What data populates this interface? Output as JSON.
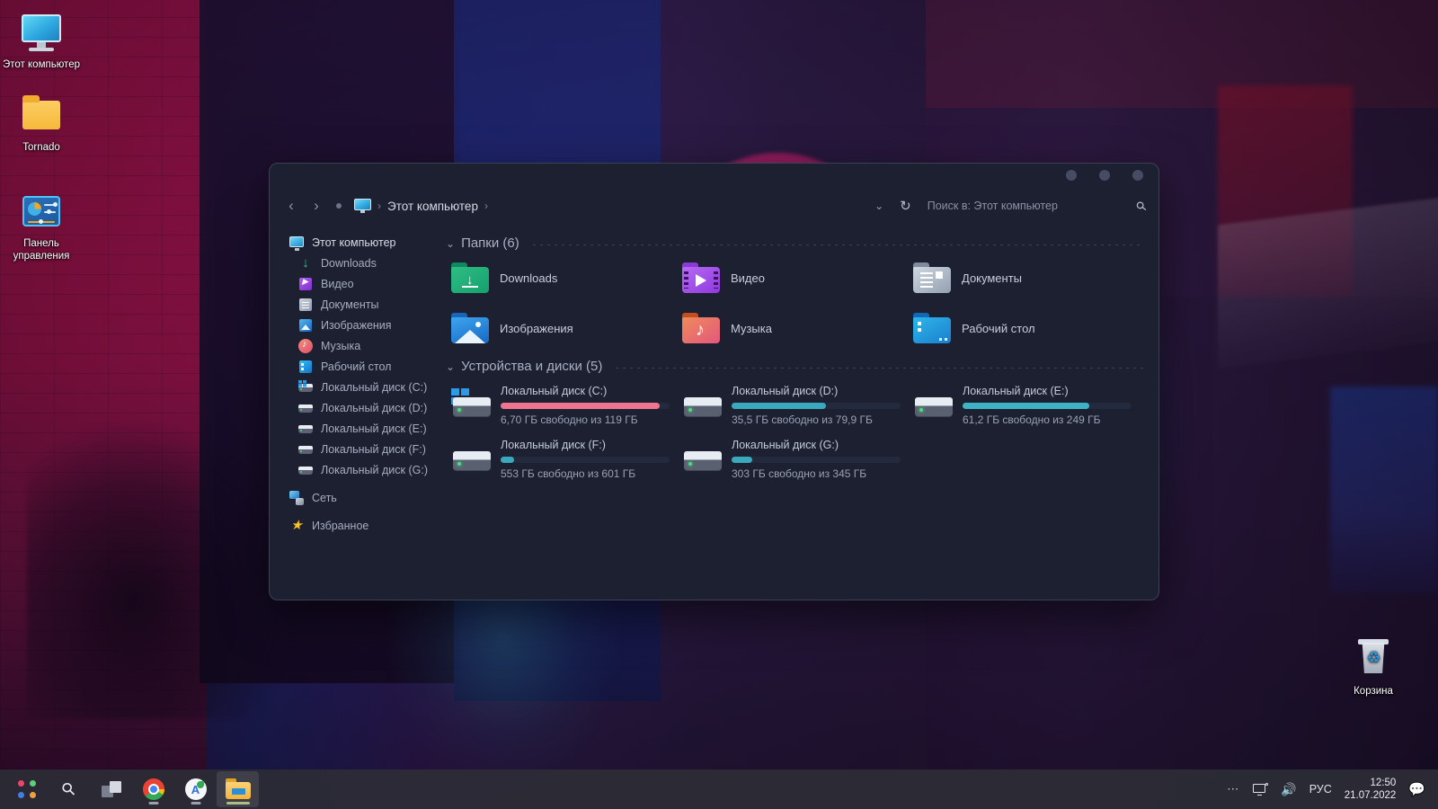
{
  "desktop": {
    "icons": [
      {
        "name": "Этот компьютер",
        "icon": "monitor-icon"
      },
      {
        "name": "Tornado",
        "icon": "folder-icon"
      },
      {
        "name": "Панель управления",
        "icon": "control-panel-icon"
      }
    ],
    "recycle_bin": {
      "label": "Корзина",
      "icon": "recycle-bin-icon"
    }
  },
  "explorer": {
    "nav": {
      "back_icon": "chevron-left-icon",
      "forward_icon": "chevron-right-icon",
      "recent_icon": "dot-icon",
      "breadcrumb_icon": "this-pc-icon",
      "breadcrumb_label": "Этот компьютер",
      "separator": "›",
      "dropdown_icon": "chevron-down-icon",
      "refresh_icon": "refresh-icon",
      "search_placeholder": "Поиск в: Этот компьютер",
      "search_value": "",
      "search_icon": "search-icon"
    },
    "window_controls": {
      "minimize": "minimize-button",
      "maximize": "maximize-button",
      "close": "close-button"
    },
    "sidebar": {
      "items": [
        {
          "label": "Этот компьютер",
          "icon": "this-pc-icon",
          "level": 0
        },
        {
          "label": "Downloads",
          "icon": "downloads-icon",
          "level": 1
        },
        {
          "label": "Видео",
          "icon": "video-icon",
          "level": 1
        },
        {
          "label": "Документы",
          "icon": "documents-icon",
          "level": 1
        },
        {
          "label": "Изображения",
          "icon": "pictures-icon",
          "level": 1
        },
        {
          "label": "Музыка",
          "icon": "music-icon",
          "level": 1
        },
        {
          "label": "Рабочий стол",
          "icon": "desktop-icon",
          "level": 1
        },
        {
          "label": "Локальный диск (C:)",
          "icon": "windows-drive-icon",
          "level": 1
        },
        {
          "label": "Локальный диск (D:)",
          "icon": "drive-icon",
          "level": 1
        },
        {
          "label": "Локальный диск (E:)",
          "icon": "drive-icon",
          "level": 1
        },
        {
          "label": "Локальный диск (F:)",
          "icon": "drive-icon",
          "level": 1
        },
        {
          "label": "Локальный диск (G:)",
          "icon": "drive-icon",
          "level": 1
        },
        {
          "label": "Сеть",
          "icon": "network-icon",
          "level": 0
        },
        {
          "label": "Избранное",
          "icon": "star-icon",
          "level": 0
        }
      ]
    },
    "sections": {
      "folders": {
        "title": "Папки (6)",
        "chevron": "chevron-down-icon",
        "items": [
          {
            "name": "Downloads",
            "icon": "downloads-folder-icon"
          },
          {
            "name": "Видео",
            "icon": "video-folder-icon"
          },
          {
            "name": "Документы",
            "icon": "documents-folder-icon"
          },
          {
            "name": "Изображения",
            "icon": "pictures-folder-icon"
          },
          {
            "name": "Музыка",
            "icon": "music-folder-icon"
          },
          {
            "name": "Рабочий стол",
            "icon": "desktop-folder-icon"
          }
        ]
      },
      "drives": {
        "title": "Устройства и диски (5)",
        "chevron": "chevron-down-icon",
        "items": [
          {
            "name": "Локальный диск (C:)",
            "free_text": "6,70 ГБ свободно из 119 ГБ",
            "used_percent": 94,
            "bar_color": "#ef7490",
            "icon": "windows-drive-icon"
          },
          {
            "name": "Локальный диск (D:)",
            "free_text": "35,5 ГБ свободно из 79,9 ГБ",
            "used_percent": 56,
            "bar_color": "#3aa8bd",
            "icon": "drive-icon"
          },
          {
            "name": "Локальный диск (E:)",
            "free_text": "61,2 ГБ свободно из 249 ГБ",
            "used_percent": 75,
            "bar_color": "#3fb3c6",
            "icon": "drive-icon"
          },
          {
            "name": "Локальный диск (F:)",
            "free_text": "553 ГБ свободно из 601 ГБ",
            "used_percent": 8,
            "bar_color": "#3aa8bd",
            "icon": "drive-icon"
          },
          {
            "name": "Локальный диск (G:)",
            "free_text": "303 ГБ свободно из 345 ГБ",
            "used_percent": 12,
            "bar_color": "#3aa8bd",
            "icon": "drive-icon"
          }
        ]
      }
    }
  },
  "taskbar": {
    "items": [
      {
        "name": "start-button",
        "icon": "start-icon",
        "active": false,
        "running": false
      },
      {
        "name": "search-button",
        "icon": "search-icon",
        "active": false,
        "running": false
      },
      {
        "name": "task-view-button",
        "icon": "task-view-icon",
        "active": false,
        "running": false
      },
      {
        "name": "chrome-button",
        "icon": "chrome-icon",
        "active": false,
        "running": true
      },
      {
        "name": "ai-app-button",
        "icon": "ai-app-icon",
        "active": false,
        "running": true
      },
      {
        "name": "file-explorer-button",
        "icon": "file-explorer-icon",
        "active": true,
        "running": true
      }
    ],
    "tray": {
      "overflow_icon": "overflow-dots-icon",
      "network_icon": "network-monitor-icon",
      "volume_icon": "speaker-icon",
      "language": "РУС",
      "time": "12:50",
      "date": "21.07.2022",
      "notifications_icon": "notification-bubble-icon"
    }
  },
  "colors": {
    "window_bg": "#1c2030",
    "taskbar_bg": "#2c2c36",
    "accent_pink": "#ef7490",
    "accent_teal": "#3aa8bd"
  }
}
